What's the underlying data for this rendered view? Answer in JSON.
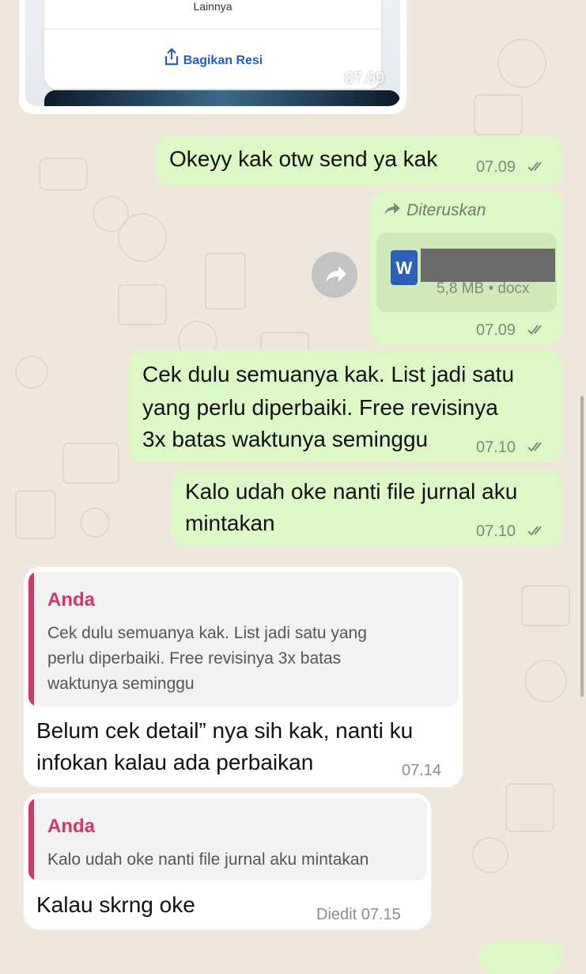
{
  "receipt": {
    "more_label": "Lainnya",
    "share_label": "Bagikan Resi",
    "time": "07.09"
  },
  "messages": [
    {
      "text": "Okeyy kak otw send ya kak",
      "time": "07.09"
    },
    {
      "forwarded_label": "Diteruskan",
      "file_meta": "5,8 MB • docx",
      "file_icon_letter": "W",
      "time": "07.09"
    },
    {
      "lines": [
        "Cek dulu semuanya kak. List jadi satu",
        "yang perlu diperbaiki. Free revisinya",
        "3x batas waktunya seminggu"
      ],
      "time": "07.10"
    },
    {
      "lines": [
        "Kalo udah oke nanti file jurnal aku",
        "mintakan"
      ],
      "time": "07.10"
    },
    {
      "quote_author": "Anda",
      "quote_lines": [
        "Cek dulu semuanya kak. List jadi satu yang",
        "perlu diperbaiki. Free revisinya 3x batas",
        "waktunya seminggu"
      ],
      "lines": [
        "Belum cek detail” nya sih kak, nanti ku",
        "infokan kalau ada perbaikan"
      ],
      "time": "07.14"
    },
    {
      "quote_author": "Anda",
      "quote_text": "Kalo udah oke nanti file jurnal aku mintakan",
      "text": "Kalau skrng oke",
      "time": "Diedit 07.15"
    }
  ],
  "colors": {
    "outgoing": "#dcf8c6",
    "incoming": "#ffffff",
    "reply_accent": "#d6336c",
    "chat_bg": "#efe7dc",
    "word_blue": "#2b5fb8"
  },
  "icons": {
    "forward": "forward-arrow-icon",
    "read": "double-check-icon",
    "share": "share-icon",
    "file": "word-doc-icon"
  }
}
